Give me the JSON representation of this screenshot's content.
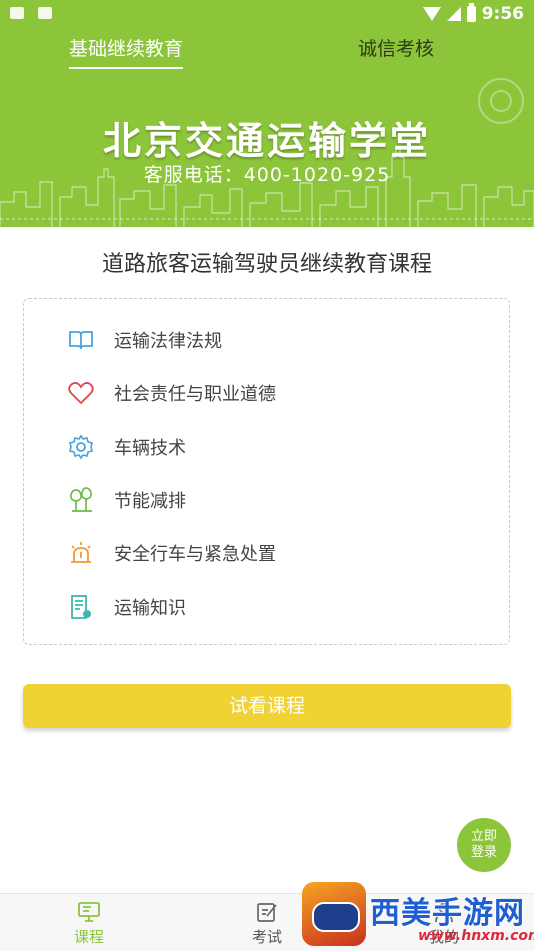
{
  "status_bar": {
    "time": "9:56"
  },
  "tabs": [
    {
      "label": "基础继续教育",
      "active": true
    },
    {
      "label": "诚信考核",
      "active": false
    }
  ],
  "banner": {
    "title": "北京交通运输学堂",
    "hotline": "客服电话：400-1020-925"
  },
  "course_title": "道路旅客运输驾驶员继续教育课程",
  "course_items": [
    {
      "label": "运输法律法规",
      "icon": "book-icon"
    },
    {
      "label": "社会责任与职业道德",
      "icon": "heart-icon"
    },
    {
      "label": "车辆技术",
      "icon": "gear-icon"
    },
    {
      "label": "节能减排",
      "icon": "tree-icon"
    },
    {
      "label": "安全行车与紧急处置",
      "icon": "alarm-light-icon"
    },
    {
      "label": "运输知识",
      "icon": "document-icon"
    }
  ],
  "try_button": "试看课程",
  "login_fab": {
    "line1": "立即",
    "line2": "登录"
  },
  "bottom_nav": [
    {
      "label": "课程",
      "active": true
    },
    {
      "label": "考试",
      "active": false
    },
    {
      "label": "我的",
      "active": false
    }
  ],
  "watermark": {
    "text": "西美手游网",
    "url": "www.hnxm.com"
  },
  "colors": {
    "brand_green": "#8cc43a",
    "button_yellow": "#f0d232",
    "icon_blue": "#4aa3d8",
    "icon_red": "#e0474c",
    "icon_orange": "#f29a2e",
    "icon_green": "#6dbb4a",
    "icon_teal": "#3cb6b0"
  }
}
